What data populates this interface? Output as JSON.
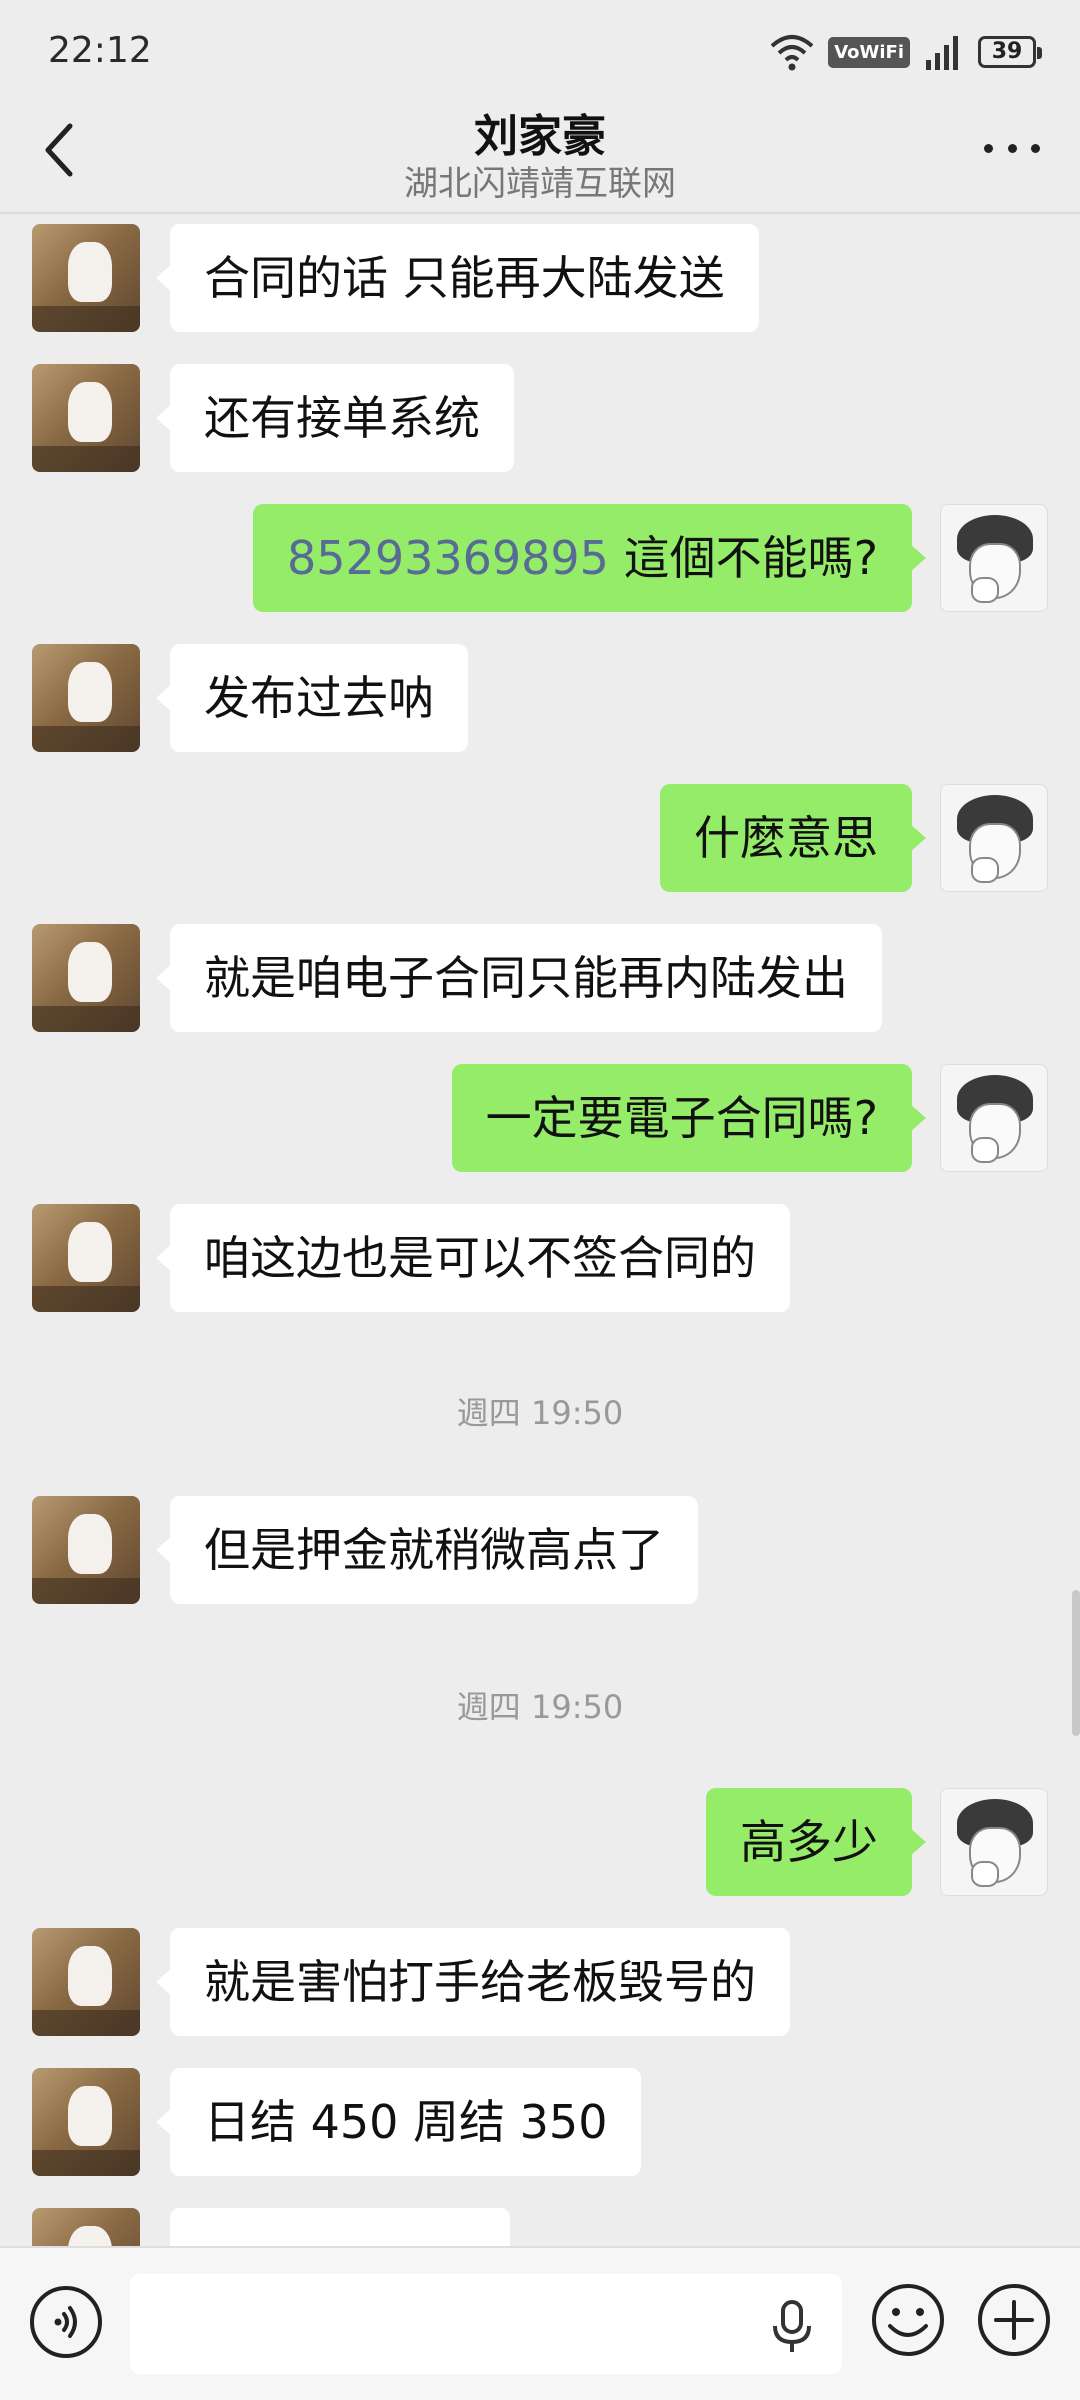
{
  "status_bar": {
    "time": "22:12",
    "network_badge": "VoWiFi",
    "battery": "39",
    "icons": [
      "wifi-icon",
      "signal-icon",
      "battery-icon"
    ]
  },
  "header": {
    "title": "刘家豪",
    "subtitle": "湖北闪靖靖互联网",
    "back_icon": "chevron-left-icon",
    "more_icon": "more-dots-icon"
  },
  "messages": [
    {
      "side": "left",
      "text": "合同的话 只能再大陆发送"
    },
    {
      "side": "left",
      "text": "还有接单系统"
    },
    {
      "side": "right",
      "phone": "85293369895",
      "text": " 這個不能嗎?"
    },
    {
      "side": "left",
      "text": "发布过去呐"
    },
    {
      "side": "right",
      "text": "什麼意思"
    },
    {
      "side": "left",
      "text": "就是咱电子合同只能再内陆发出"
    },
    {
      "side": "right",
      "text": "一定要電子合同嗎?"
    },
    {
      "side": "left",
      "text": "咱这边也是可以不签合同的"
    },
    {
      "type": "timestamp",
      "text": "週四 19:50"
    },
    {
      "side": "left",
      "text": "但是押金就稍微高点了"
    },
    {
      "type": "timestamp",
      "text": "週四 19:50"
    },
    {
      "side": "right",
      "text": "高多少"
    },
    {
      "side": "left",
      "text": "就是害怕打手给老板毁号的"
    },
    {
      "side": "left",
      "text": "日结 450 周结 350"
    },
    {
      "side": "left",
      "text": ""
    }
  ],
  "input_bar": {
    "placeholder": "",
    "icons": [
      "voice-icon",
      "mic-icon",
      "emoji-icon",
      "plus-icon"
    ]
  },
  "colors": {
    "background": "#ededed",
    "bubble_outgoing": "#95ec69",
    "bubble_incoming": "#ffffff",
    "link": "#576b95"
  }
}
